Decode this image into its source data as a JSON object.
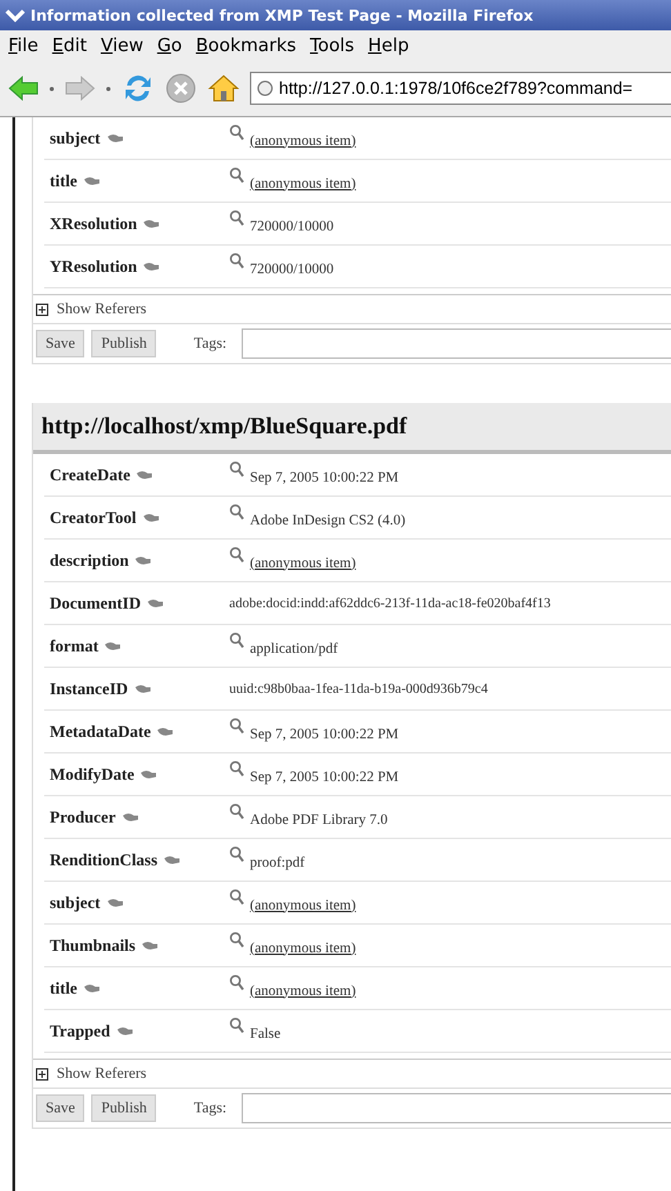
{
  "window": {
    "title": "Information collected from XMP Test Page - Mozilla Firefox"
  },
  "menu": [
    {
      "label": "File"
    },
    {
      "label": "Edit"
    },
    {
      "label": "View"
    },
    {
      "label": "Go"
    },
    {
      "label": "Bookmarks"
    },
    {
      "label": "Tools"
    },
    {
      "label": "Help"
    }
  ],
  "toolbar": {
    "back_disabled": false,
    "forward_disabled": true,
    "url": "http://127.0.0.1:1978/10f6ce2f789?command="
  },
  "sections": [
    {
      "rows": [
        {
          "name": "subject",
          "kind": "link",
          "value": "(anonymous item)"
        },
        {
          "name": "title",
          "kind": "link",
          "value": "(anonymous item)"
        },
        {
          "name": "XResolution",
          "kind": "text",
          "value": "720000/10000"
        },
        {
          "name": "YResolution",
          "kind": "text",
          "value": "720000/10000"
        }
      ],
      "referers": "Show Referers",
      "buttons": [
        "Save",
        "Publish"
      ],
      "tags_label": "Tags:"
    },
    {
      "title": "http://localhost/xmp/BlueSquare.pdf",
      "rows": [
        {
          "name": "CreateDate",
          "kind": "text",
          "value": "Sep 7, 2005 10:00:22 PM"
        },
        {
          "name": "CreatorTool",
          "kind": "text",
          "value": "Adobe InDesign CS2 (4.0)"
        },
        {
          "name": "description",
          "kind": "link",
          "value": "(anonymous item)"
        },
        {
          "name": "DocumentID",
          "kind": "id",
          "value": "adobe:docid:indd:af62ddc6-213f-11da-ac18-fe020baf4f13"
        },
        {
          "name": "format",
          "kind": "text",
          "value": "application/pdf"
        },
        {
          "name": "InstanceID",
          "kind": "id",
          "value": "uuid:c98b0baa-1fea-11da-b19a-000d936b79c4"
        },
        {
          "name": "MetadataDate",
          "kind": "text",
          "value": "Sep 7, 2005 10:00:22 PM"
        },
        {
          "name": "ModifyDate",
          "kind": "text",
          "value": "Sep 7, 2005 10:00:22 PM"
        },
        {
          "name": "Producer",
          "kind": "text",
          "value": "Adobe PDF Library 7.0"
        },
        {
          "name": "RenditionClass",
          "kind": "text",
          "value": "proof:pdf"
        },
        {
          "name": "subject",
          "kind": "link",
          "value": "(anonymous item)"
        },
        {
          "name": "Thumbnails",
          "kind": "link",
          "value": "(anonymous item)"
        },
        {
          "name": "title",
          "kind": "link",
          "value": "(anonymous item)"
        },
        {
          "name": "Trapped",
          "kind": "text",
          "value": "False"
        }
      ],
      "referers": "Show Referers",
      "buttons": [
        "Save",
        "Publish"
      ],
      "tags_label": "Tags:"
    }
  ]
}
